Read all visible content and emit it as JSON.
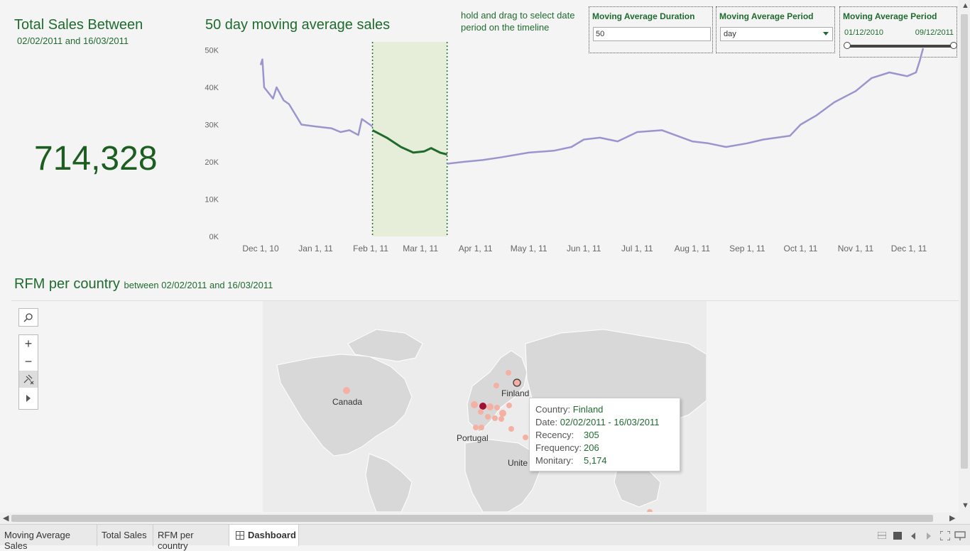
{
  "kpi": {
    "title": "Total Sales Between",
    "dates": "02/02/2011  and 16/03/2011",
    "value": "714,328"
  },
  "chart": {
    "title": "50 day moving average sales"
  },
  "hint": "hold and drag to select date period on the timeline",
  "filters": {
    "duration": {
      "title": "Moving Average Duration",
      "value": "50"
    },
    "period": {
      "title": "Moving Average Period",
      "value": "day"
    },
    "range": {
      "title": "Moving Average Period",
      "from": "01/12/2010",
      "to": "09/12/2011"
    }
  },
  "chart_data": {
    "type": "line",
    "title": "50 day moving average sales",
    "x_ticks": [
      "Dec 1, 10",
      "Jan 1, 11",
      "Feb 1, 11",
      "Mar 1, 11",
      "Apr 1, 11",
      "May 1, 11",
      "Jun 1, 11",
      "Jul 1, 11",
      "Aug 1, 11",
      "Sep 1, 11",
      "Oct 1, 11",
      "Nov 1, 11",
      "Dec 1, 11"
    ],
    "y_ticks": [
      "0K",
      "10K",
      "20K",
      "30K",
      "40K",
      "50K"
    ],
    "ylim": [
      0,
      52000
    ],
    "selection": {
      "from": "2011-02-02",
      "to": "2011-03-16"
    },
    "series": [
      {
        "color": "#9a95cf",
        "points": [
          [
            "2010-12-01",
            46000
          ],
          [
            "2010-12-02",
            47500
          ],
          [
            "2010-12-03",
            40000
          ],
          [
            "2010-12-08",
            37000
          ],
          [
            "2010-12-10",
            40000
          ],
          [
            "2010-12-14",
            36500
          ],
          [
            "2010-12-17",
            35500
          ],
          [
            "2010-12-24",
            30000
          ],
          [
            "2011-01-01",
            29500
          ],
          [
            "2011-01-10",
            29000
          ],
          [
            "2011-01-15",
            28000
          ],
          [
            "2011-01-20",
            28500
          ],
          [
            "2011-01-25",
            27200
          ],
          [
            "2011-01-27",
            31500
          ],
          [
            "2011-02-02",
            29500
          ]
        ]
      },
      {
        "color": "#1f6b2e",
        "points": [
          [
            "2011-02-02",
            28500
          ],
          [
            "2011-02-10",
            26500
          ],
          [
            "2011-02-18",
            24000
          ],
          [
            "2011-02-25",
            22500
          ],
          [
            "2011-03-03",
            22800
          ],
          [
            "2011-03-07",
            23700
          ],
          [
            "2011-03-12",
            22500
          ],
          [
            "2011-03-16",
            22000
          ]
        ]
      },
      {
        "color": "#9a95cf",
        "points": [
          [
            "2011-03-16",
            19500
          ],
          [
            "2011-03-25",
            20000
          ],
          [
            "2011-04-05",
            20500
          ],
          [
            "2011-04-15",
            21200
          ],
          [
            "2011-05-01",
            22500
          ],
          [
            "2011-05-15",
            23000
          ],
          [
            "2011-05-25",
            24000
          ],
          [
            "2011-06-01",
            26000
          ],
          [
            "2011-06-10",
            26500
          ],
          [
            "2011-06-20",
            25500
          ],
          [
            "2011-07-01",
            28000
          ],
          [
            "2011-07-15",
            28500
          ],
          [
            "2011-08-01",
            25500
          ],
          [
            "2011-08-10",
            25000
          ],
          [
            "2011-08-20",
            24000
          ],
          [
            "2011-09-01",
            25000
          ],
          [
            "2011-09-10",
            26000
          ],
          [
            "2011-09-25",
            27000
          ],
          [
            "2011-10-01",
            30000
          ],
          [
            "2011-10-10",
            32500
          ],
          [
            "2011-10-20",
            36000
          ],
          [
            "2011-11-01",
            39000
          ],
          [
            "2011-11-10",
            42500
          ],
          [
            "2011-11-20",
            44000
          ],
          [
            "2011-11-30",
            43000
          ],
          [
            "2011-12-05",
            44000
          ],
          [
            "2011-12-07",
            47000
          ],
          [
            "2011-12-09",
            50500
          ]
        ]
      }
    ]
  },
  "rfm": {
    "title": "RFM per country",
    "subtitle": "between 02/02/2011 and 16/03/2011",
    "labels": {
      "canada": "Canada",
      "finland": "Finland",
      "portugal": "Portugal",
      "united": "Unite"
    },
    "tooltip": {
      "country_label": "Country:",
      "country_value": "Finland",
      "date_label": "Date:",
      "date_value": "02/02/2011  -  16/03/2011",
      "recency_label": "Recency:",
      "recency_value": "305",
      "frequency_label": "Frequency:",
      "frequency_value": "206",
      "monitary_label": "Monitary:",
      "monitary_value": "5,174"
    }
  },
  "tabs": [
    "Moving Average Sales",
    "Total Sales",
    "RFM per country",
    "Dashboard"
  ]
}
